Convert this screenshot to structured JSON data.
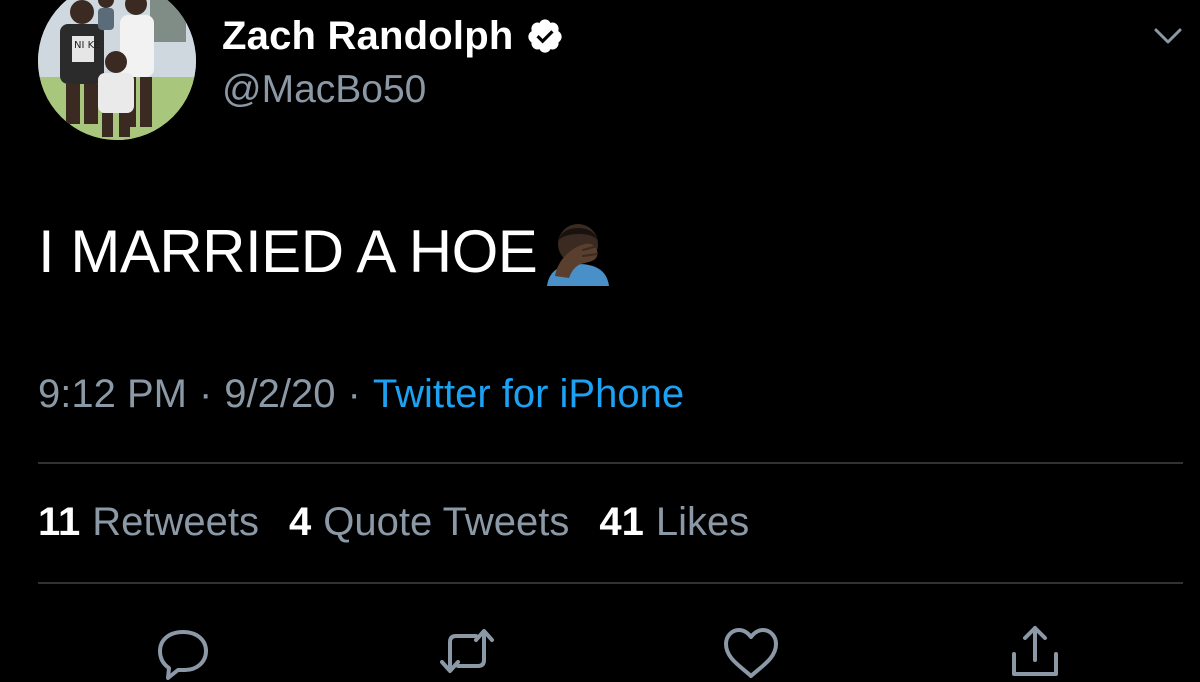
{
  "tweet": {
    "author": {
      "display_name": "Zach Randolph",
      "handle": "@MacBo50",
      "verified": true,
      "avatar_shirt_text": "NI KE"
    },
    "text": "I MARRIED A HOE",
    "emoji": "facepalm-icon",
    "time": "9:12 PM",
    "separator": "·",
    "date": "9/2/20",
    "source": "Twitter for iPhone",
    "stats": {
      "retweets_count": "11",
      "retweets_label": "Retweets",
      "quotes_count": "4",
      "quotes_label": "Quote Tweets",
      "likes_count": "41",
      "likes_label": "Likes"
    },
    "actions": [
      "reply-icon",
      "retweet-icon",
      "like-icon",
      "share-icon"
    ]
  },
  "colors": {
    "background": "#000000",
    "primary_text": "#ffffff",
    "secondary_text": "#8b98a5",
    "accent": "#1da1f2",
    "divider": "#2f3336"
  }
}
